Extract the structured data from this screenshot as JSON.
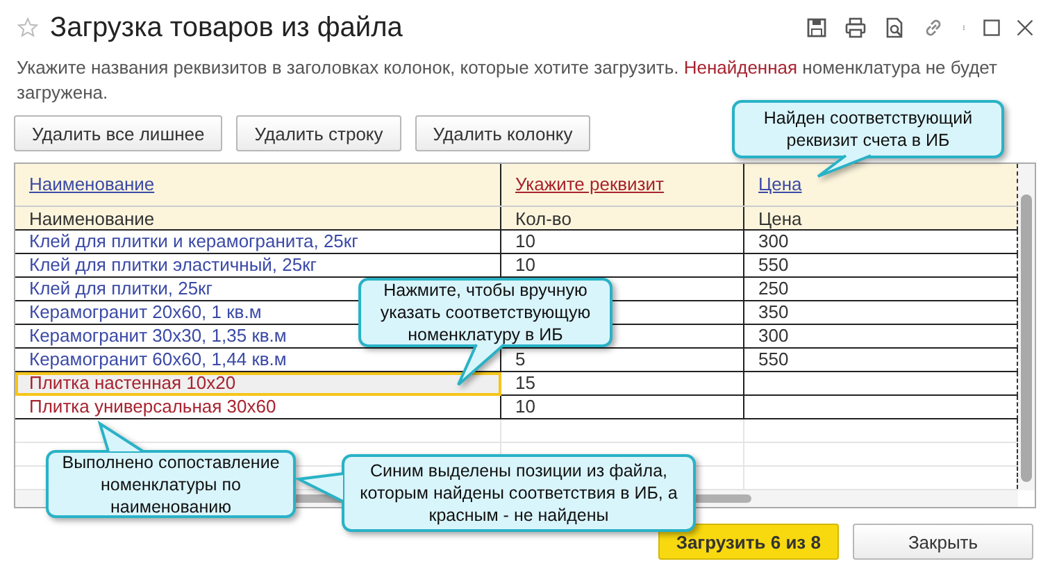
{
  "window": {
    "title": "Загрузка товаров из файла"
  },
  "hint": [
    {
      "kind": "normal",
      "text": "Укажите названия реквизитов в заголовках колонок, которые хотите загрузить. "
    },
    {
      "kind": "warning",
      "text": "Ненайденная"
    },
    {
      "kind": "normal",
      "text": " номенклатура не будет загружена."
    }
  ],
  "toolbar_buttons": [
    "Удалить все лишнее",
    "Удалить строку",
    "Удалить колонку"
  ],
  "table": {
    "columns": [
      {
        "label": "Наименование",
        "matched": true
      },
      {
        "label": "Укажите реквизит",
        "matched": false
      },
      {
        "label": "Цена",
        "matched": true
      }
    ],
    "file_headers": [
      "Наименование",
      "Кол-во",
      "Цена"
    ],
    "rows": [
      {
        "name": "Клей для плитки и керамогранита, 25кг",
        "qty": "10",
        "price": "300",
        "matched": true,
        "selected": false
      },
      {
        "name": "Клей для плитки эластичный, 25кг",
        "qty": "10",
        "price": "550",
        "matched": true,
        "selected": false
      },
      {
        "name": "Клей для плитки, 25кг",
        "price": "250",
        "matched": true,
        "selected": false
      },
      {
        "name": "Керамогранит 20х60, 1 кв.м",
        "price": "350",
        "matched": true,
        "selected": false
      },
      {
        "name": "Керамогранит 30х30, 1,35 кв.м",
        "price": "300",
        "matched": true,
        "selected": false
      },
      {
        "name": "Керамогранит 60х60, 1,44 кв.м",
        "qty": "5",
        "price": "550",
        "matched": true,
        "selected": false
      },
      {
        "name": "Плитка настенная 10х20",
        "qty": "15",
        "matched": false,
        "selected": true
      },
      {
        "name": "Плитка универсальная 30х60",
        "qty": "10",
        "matched": false,
        "selected": false
      }
    ]
  },
  "callouts": [
    "Найден соответствующий реквизит счета в ИБ",
    "Нажмите, чтобы вручную указать соответствующую номенклатуру в ИБ",
    "Выполнено сопоставление номенклатуры по наименованию",
    "Синим выделены позиции из файла, которым найдены соответствия в ИБ, а красным - не найдены"
  ],
  "footer_buttons": [
    {
      "label": "Загрузить 6 из 8",
      "kind": "primary"
    },
    {
      "label": "Закрыть",
      "kind": "normal"
    }
  ]
}
